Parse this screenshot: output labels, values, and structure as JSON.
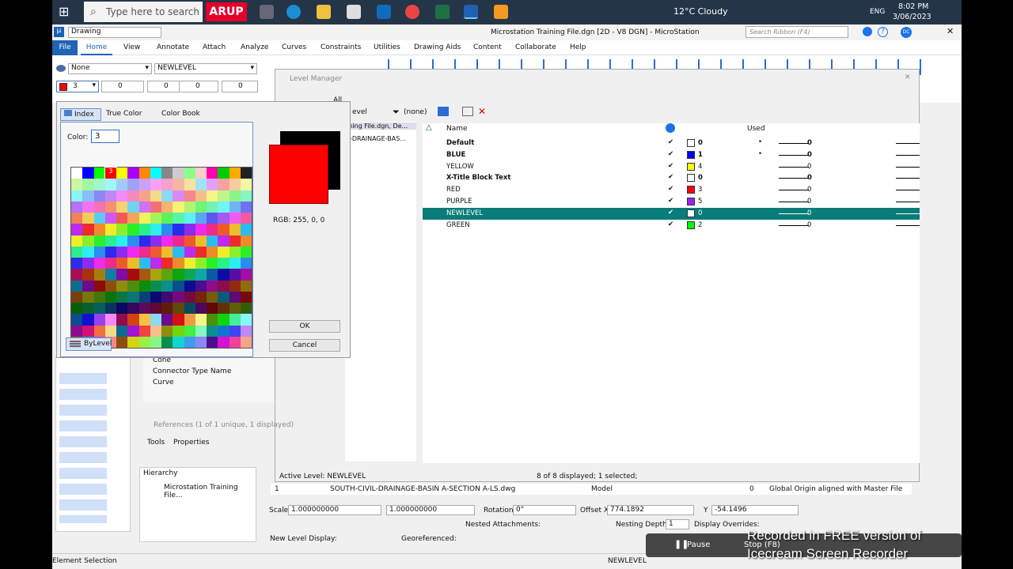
{
  "taskbar": {
    "search_placeholder": "Type here to search",
    "arup": "ARUP",
    "weather": "12°C  Cloudy",
    "lang": "ENG",
    "time": "8:02 PM",
    "date": "3/06/2023"
  },
  "app": {
    "title": "Microstation Training File.dgn [2D - V8 DGN] - MicroStation",
    "workflow": "Drawing",
    "search_ribbon": "Search Ribbon (F4)"
  },
  "ribbon_tabs": [
    "File",
    "Home",
    "View",
    "Annotate",
    "Attach",
    "Analyze",
    "Curves",
    "Constraints",
    "Utilities",
    "Drawing Aids",
    "Content",
    "Collaborate",
    "Help"
  ],
  "attributes": {
    "level_none": "None",
    "level": "NEWLEVEL",
    "color": "3",
    "weight": "0",
    "style": "0",
    "trans": "0",
    "prio": "0"
  },
  "level_manager": {
    "title": "Level Manager",
    "filter": "(none)",
    "filter_all": "All",
    "tree_item": "ining File.dgn, De...",
    "tree_item2": "_-DRAINAGE-BAS...",
    "tree_item3": "evel",
    "headers": {
      "name": "Name",
      "used": "Used"
    },
    "rows": [
      {
        "name": "Default",
        "num": "0",
        "used": "•",
        "w": "0",
        "bold": true,
        "color": "#ffffff"
      },
      {
        "name": "BLUE",
        "num": "1",
        "used": "•",
        "w": "0",
        "bold": true,
        "color": "#0000ff"
      },
      {
        "name": "YELLOW",
        "num": "4",
        "used": "",
        "w": "0",
        "bold": false,
        "color": "#ffff00"
      },
      {
        "name": "X-Title Block Text",
        "num": "0",
        "used": "",
        "w": "0",
        "bold": true,
        "color": "#ffffff"
      },
      {
        "name": "RED",
        "num": "3",
        "used": "",
        "w": "0",
        "bold": false,
        "color": "#ff0000"
      },
      {
        "name": "PURPLE",
        "num": "5",
        "used": "",
        "w": "0",
        "bold": false,
        "color": "#a020f0"
      },
      {
        "name": "NEWLEVEL",
        "num": "0",
        "used": "",
        "w": "0",
        "bold": false,
        "color": "#ffffff",
        "selected": true
      },
      {
        "name": "GREEN",
        "num": "2",
        "used": "",
        "w": "0",
        "bold": false,
        "color": "#00ff00"
      }
    ],
    "status_active": "Active Level: NEWLEVEL",
    "status_count": "8 of 8 displayed; 1 selected;"
  },
  "color_picker": {
    "tabs": [
      "Index",
      "True Color",
      "Color Book"
    ],
    "color_label": "Color:",
    "color_value": "3",
    "rgb": "RGB: 255, 0, 0",
    "ok": "OK",
    "cancel": "Cancel",
    "bylevel": "ByLevel",
    "selected_index": "3"
  },
  "properties": {
    "items": [
      "Cone",
      "Connector Type Name",
      "Curve"
    ]
  },
  "references": {
    "title": "References (1 of 1 unique, 1 displayed)",
    "tools": "Tools",
    "props": "Properties",
    "hierarchy": "Hierarchy",
    "tree_item": "Microstation Training File...",
    "row_num": "1",
    "row_file": "SOUTH-CIVIL-DRAINAGE-BASIN A-SECTION A-LS.dwg",
    "row_model": "Model",
    "row_desc": "Global Origin aligned with Master File",
    "row_zero": "0",
    "scale_label": "Scale",
    "scale1": "1.000000000",
    "scale2": "1.000000000",
    "rotation_label": "Rotation",
    "rotation": "0°",
    "offsetx_label": "Offset X",
    "offsetx": "774.1892",
    "y_label": "Y",
    "y": "-54.1496",
    "nested_label": "Nested Attachments:",
    "depth_label": "Nesting Depth:",
    "depth": "1",
    "display_overrides": "Display Overrides:",
    "new_level_label": "New Level Display:",
    "georef_label": "Georeferenced:"
  },
  "statusbar": {
    "left": "Element Selection",
    "level": "NEWLEVEL"
  },
  "recorder": {
    "pause": "Pause",
    "stop": "Stop (F8)",
    "watermark1": "Recorded in FREE version of",
    "watermark2": "Icecream Screen Recorder"
  }
}
